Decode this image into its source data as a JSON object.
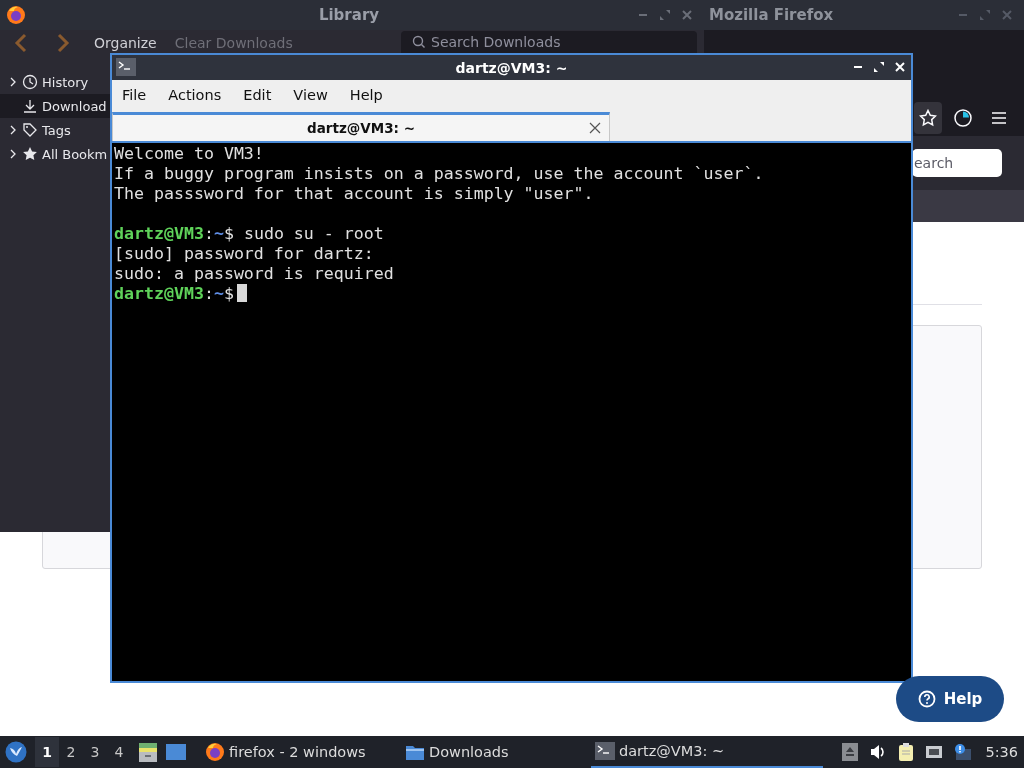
{
  "library": {
    "title": "Library",
    "toolbar": {
      "organize": "Organize",
      "clear": "Clear Downloads",
      "search_placeholder": "Search Downloads"
    },
    "sidebar": [
      {
        "label": "History",
        "kind": "clock",
        "expandable": true,
        "selected": false
      },
      {
        "label": "Download",
        "kind": "download",
        "expandable": false,
        "selected": true
      },
      {
        "label": "Tags",
        "kind": "tag",
        "expandable": true,
        "selected": false
      },
      {
        "label": "All Bookm",
        "kind": "star",
        "expandable": true,
        "selected": false
      }
    ]
  },
  "firefox": {
    "title": "Mozilla Firefox",
    "search": {
      "placeholder": "earch"
    },
    "help_button": "Help"
  },
  "terminal": {
    "title": "dartz@VM3: ~",
    "menu": [
      "File",
      "Actions",
      "Edit",
      "View",
      "Help"
    ],
    "tabs": [
      {
        "label": "dartz@VM3: ~",
        "selected": true
      }
    ],
    "lines": [
      {
        "kind": "text",
        "text": "Welcome to VM3!"
      },
      {
        "kind": "text",
        "text": "If a buggy program insists on a password, use the account `user`."
      },
      {
        "kind": "text",
        "text": "The passsword for that account is simply \"user\"."
      },
      {
        "kind": "blank"
      },
      {
        "kind": "prompt",
        "user": "dartz@VM3",
        "sep": ":",
        "path": "~",
        "symbol": "$",
        "command": "sudo su - root",
        "cursor": false
      },
      {
        "kind": "text",
        "text": "[sudo] password for dartz:"
      },
      {
        "kind": "text",
        "text": "sudo: a password is required"
      },
      {
        "kind": "prompt",
        "user": "dartz@VM3",
        "sep": ":",
        "path": "~",
        "symbol": "$",
        "cursor": true
      }
    ]
  },
  "taskbar": {
    "workspaces": [
      {
        "label": "1",
        "selected": true
      },
      {
        "label": "2",
        "selected": false
      },
      {
        "label": "3",
        "selected": false
      },
      {
        "label": "4",
        "selected": false
      }
    ],
    "tasks": [
      {
        "label": "firefox - 2 windows",
        "kind": "firefox",
        "selected": false
      },
      {
        "label": "Downloads",
        "kind": "folder",
        "selected": false
      },
      {
        "label": "dartz@VM3: ~",
        "kind": "terminal",
        "selected": true
      }
    ],
    "clock": "5:36"
  }
}
